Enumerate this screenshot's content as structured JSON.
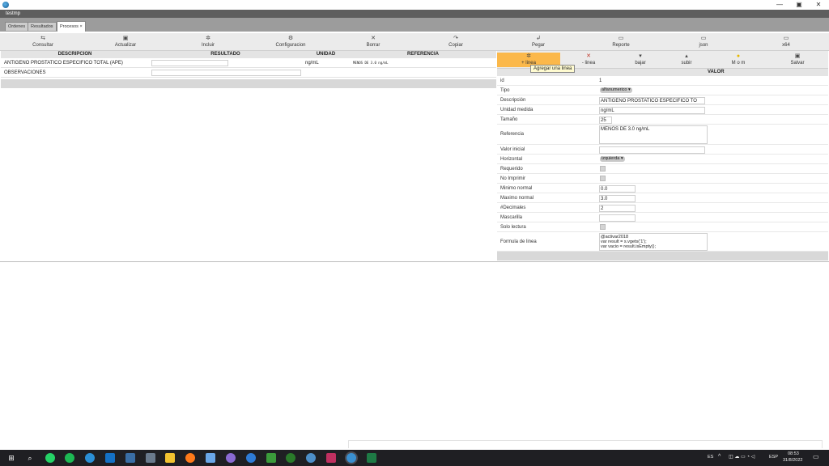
{
  "window": {
    "title": "testmp",
    "minimize": "—",
    "maximize": "▣",
    "close": "✕"
  },
  "tabs": [
    "Ordenes",
    "Resultados",
    "Procesos ×"
  ],
  "left_toolbar": [
    {
      "label": "Consultar",
      "icon": "⇆"
    },
    {
      "label": "Actualizar",
      "icon": "▣"
    },
    {
      "label": "Incluir",
      "icon": "✲"
    },
    {
      "label": "Configuracion",
      "icon": "⚙"
    },
    {
      "label": "Borrar",
      "icon": "✕"
    },
    {
      "label": "Copiar",
      "icon": "↷"
    },
    {
      "label": "Pegar",
      "icon": "↲"
    },
    {
      "label": "Reporte",
      "icon": "▭"
    },
    {
      "label": "json",
      "icon": "▭"
    },
    {
      "label": "x64",
      "icon": "▭"
    }
  ],
  "right_toolbar": [
    {
      "label": "+ linea",
      "icon": "✲"
    },
    {
      "label": "- linea",
      "icon": "✕"
    },
    {
      "label": "bajar",
      "icon": "▾"
    },
    {
      "label": "subir",
      "icon": "▴"
    },
    {
      "label": "M o m",
      "icon": "●"
    },
    {
      "label": "Salvar",
      "icon": "▣"
    }
  ],
  "tooltip": "Agregar una linea",
  "grid": {
    "headers": [
      "DESCRIPCION",
      "RESULTADO",
      "UNIDAD",
      "REFERENCIA"
    ],
    "rows": [
      {
        "descripcion": "ANTIGENO PROSTATICO ESPECIFICO TOTAL (APE)",
        "unidad": "ng/mL",
        "referencia": "MENOS DE 3.0 ng/mL"
      },
      {
        "descripcion": "OBSERVACIONES",
        "unidad": "",
        "referencia": ""
      }
    ]
  },
  "props": {
    "header": "VALOR",
    "rows": [
      {
        "label": "id",
        "value": "1"
      },
      {
        "label": "Tipo",
        "value": "alfanumerico ▾"
      },
      {
        "label": "Descripción",
        "value": "ANTIGENO PROSTATICO ESPECIFICO TO"
      },
      {
        "label": "Unidad medida",
        "value": "ng/mL"
      },
      {
        "label": "Tamaño",
        "value": "25"
      },
      {
        "label": "Referencia",
        "value": "MENOS DE 3.0 ng/mL"
      },
      {
        "label": "Valor inicial",
        "value": ""
      },
      {
        "label": "Horizontal",
        "value": "izquierda ▾"
      },
      {
        "label": "Requerido",
        "value": ""
      },
      {
        "label": "No Imprimir",
        "value": ""
      },
      {
        "label": "Minimo normal",
        "value": "0.0"
      },
      {
        "label": "Maximo normal",
        "value": "3.0"
      },
      {
        "label": "#Decimales",
        "value": "2"
      },
      {
        "label": "Mascarilla",
        "value": ""
      },
      {
        "label": "Solo lectura",
        "value": ""
      },
      {
        "label": "Formula de linea",
        "value": "@activar2018\nvar result = s.vgets('1');\nvar vacio = result.isEmpty();"
      }
    ]
  },
  "taskbar": {
    "lang_short": "ES",
    "lang": "ESP",
    "time": "08:53",
    "date": "31/8/2022"
  }
}
